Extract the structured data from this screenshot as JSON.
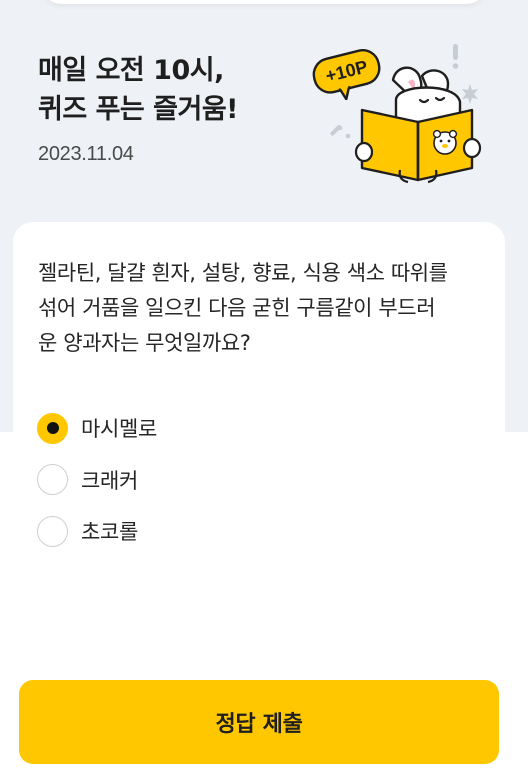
{
  "header": {
    "title_line1": "매일 오전 10시,",
    "title_line2": "퀴즈 푸는 즐거움!",
    "date": "2023.11.04",
    "badge_text": "+10P",
    "accent_color": "#ffc700",
    "background_color": "#eef1f6"
  },
  "quiz": {
    "question_lines": [
      "젤라틴, 달걀 흰자, 설탕, 향료, 식용 색소 따위를",
      "섞어 거품을 일으킨 다음 굳힌 구름같이 부드러",
      "운 양과자는 무엇일까요?"
    ],
    "options": [
      {
        "label": "마시멜로",
        "selected": true
      },
      {
        "label": "크래커",
        "selected": false
      },
      {
        "label": "초코롤",
        "selected": false
      }
    ]
  },
  "footer": {
    "submit_label": "정답 제출"
  },
  "icons": {
    "illustration": "rabbit-reading-book-illustration",
    "badge": "points-badge-icon",
    "radio": "radio-button-icon"
  }
}
